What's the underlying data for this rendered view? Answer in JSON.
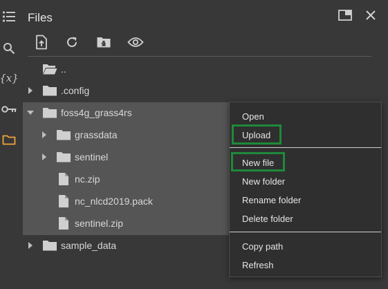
{
  "panel": {
    "title": "Files",
    "header_buttons": [
      {
        "name": "open-in-tab",
        "icon": "open-in-tab-icon"
      },
      {
        "name": "close",
        "icon": "close-icon"
      }
    ]
  },
  "rail": {
    "items": [
      {
        "name": "table-of-contents",
        "icon": "list-icon"
      },
      {
        "name": "search",
        "icon": "search-icon"
      },
      {
        "name": "variables",
        "icon": "variables-icon",
        "glyph": "{x}"
      },
      {
        "name": "secrets",
        "icon": "key-icon"
      },
      {
        "name": "files",
        "icon": "folder-icon",
        "active": true
      }
    ],
    "active_color": "#f0a33c"
  },
  "toolbar": {
    "buttons": [
      {
        "name": "upload",
        "icon": "upload-file-icon"
      },
      {
        "name": "refresh",
        "icon": "refresh-icon"
      },
      {
        "name": "mount-drive",
        "icon": "drive-folder-icon"
      },
      {
        "name": "show-hidden",
        "icon": "eye-icon"
      }
    ]
  },
  "tree": {
    "items": [
      {
        "label": "..",
        "type": "folder-open",
        "expanded": null
      },
      {
        "label": ".config",
        "type": "folder",
        "expanded": false
      },
      {
        "label": "foss4g_grass4rs",
        "type": "folder",
        "expanded": true
      },
      {
        "label": "grassdata",
        "type": "folder",
        "expanded": false
      },
      {
        "label": "sentinel",
        "type": "folder",
        "expanded": false
      },
      {
        "label": "nc.zip",
        "type": "file"
      },
      {
        "label": "nc_nlcd2019.pack",
        "type": "file"
      },
      {
        "label": "sentinel.zip",
        "type": "file"
      },
      {
        "label": "sample_data",
        "type": "folder",
        "expanded": false
      }
    ]
  },
  "context_menu": {
    "groups": [
      [
        "Open",
        "Upload"
      ],
      [
        "New file",
        "New folder",
        "Rename folder",
        "Delete folder"
      ],
      [
        "Copy path",
        "Refresh"
      ]
    ],
    "highlighted": [
      "Upload",
      "New file"
    ],
    "highlight_color": "#1e8a3a"
  }
}
